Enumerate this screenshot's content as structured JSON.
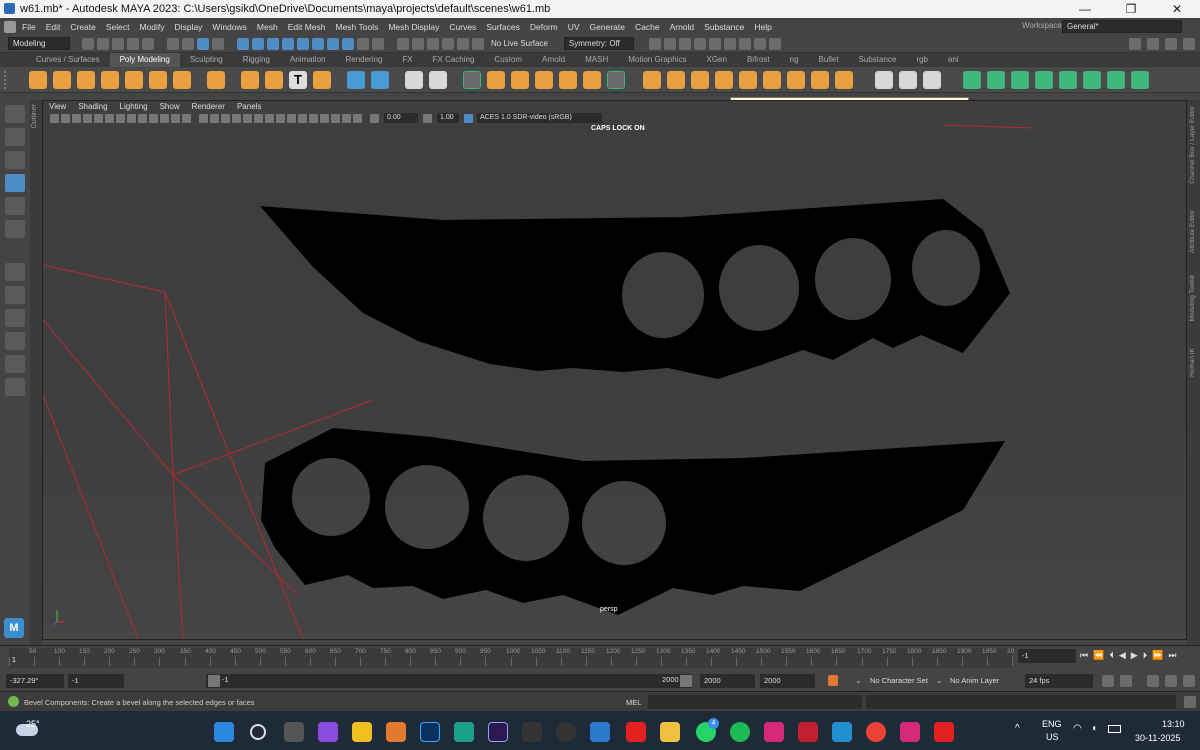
{
  "window": {
    "title": "w61.mb* - Autodesk MAYA 2023: C:\\Users\\gsikd\\OneDrive\\Documents\\maya\\projects\\default\\scenes\\w61.mb"
  },
  "menus": [
    "File",
    "Edit",
    "Create",
    "Select",
    "Modify",
    "Display",
    "Windows",
    "Mesh",
    "Edit Mesh",
    "Mesh Tools",
    "Mesh Display",
    "Curves",
    "Surfaces",
    "Deform",
    "UV",
    "Generate",
    "Cache",
    "Arnold",
    "Substance",
    "Help"
  ],
  "workspace": {
    "label": "Workspace:",
    "value": "General*"
  },
  "status_line": {
    "mode": "Modeling",
    "live_surface": "No Live Surface",
    "symmetry": "Symmetry: Off"
  },
  "shelf_tabs": [
    "Curves / Surfaces",
    "Poly Modeling",
    "Sculpting",
    "Rigging",
    "Animation",
    "Rendering",
    "FX",
    "FX Caching",
    "Custom",
    "Arnold",
    "MASH",
    "Motion Graphics",
    "XGen",
    "Bifrost",
    "ng",
    "Bullet",
    "Substance",
    "rgb",
    "ani"
  ],
  "shelf_active": "Poly Modeling",
  "tooltip": "Bevel Components: Create a bevel along the selected edges or faces",
  "panel_menu": [
    "View",
    "Shading",
    "Lighting",
    "Show",
    "Renderer",
    "Panels"
  ],
  "panel_fields": {
    "exposure": "0.00",
    "gamma": "1.00",
    "color_space": "ACES 1.0 SDR-video (sRGB)"
  },
  "viewport": {
    "caps_lock": "CAPS LOCK ON",
    "camera": "persp"
  },
  "side_labels": {
    "left": "Outliner",
    "right": [
      "Channel Box / Layer Editor",
      "Attribute Editor",
      "Modeling Toolkit",
      "Human IK"
    ]
  },
  "timeline": {
    "ticks": [
      "1",
      "50",
      "100",
      "150",
      "200",
      "250",
      "300",
      "350",
      "400",
      "450",
      "500",
      "550",
      "600",
      "650",
      "700",
      "750",
      "800",
      "850",
      "900",
      "950",
      "1000",
      "1050",
      "1100",
      "1150",
      "1200",
      "1250",
      "1300",
      "1350",
      "1400",
      "1450",
      "1500",
      "1550",
      "1600",
      "1650",
      "1700",
      "1750",
      "1800",
      "1850",
      "1900",
      "1950",
      "20"
    ],
    "current_frame": "1"
  },
  "range": {
    "coord": "-327.29°",
    "field_b": "-1",
    "range_start": "-1",
    "range_end": "2000",
    "end_a": "2000",
    "end_b": "2000",
    "character_set": "No Character Set",
    "anim_layer": "No Anim Layer",
    "fps": "24 fps"
  },
  "help_line": {
    "text": "Bevel Components: Create a bevel along the selected edges or faces",
    "mel_label": "MEL"
  },
  "taskbar": {
    "weather": "25°",
    "lang_a": "ENG",
    "lang_b": "US",
    "time": "13:10",
    "date": "30-11-2025",
    "whatsapp_badge": "4"
  },
  "colors": {
    "viewport_bg": "#3e3e3e",
    "shape_fill": "#000000",
    "hole_fill": "#3e3e3e",
    "grid_red": "#b8282e",
    "accent_blue": "#4d8cc4"
  }
}
